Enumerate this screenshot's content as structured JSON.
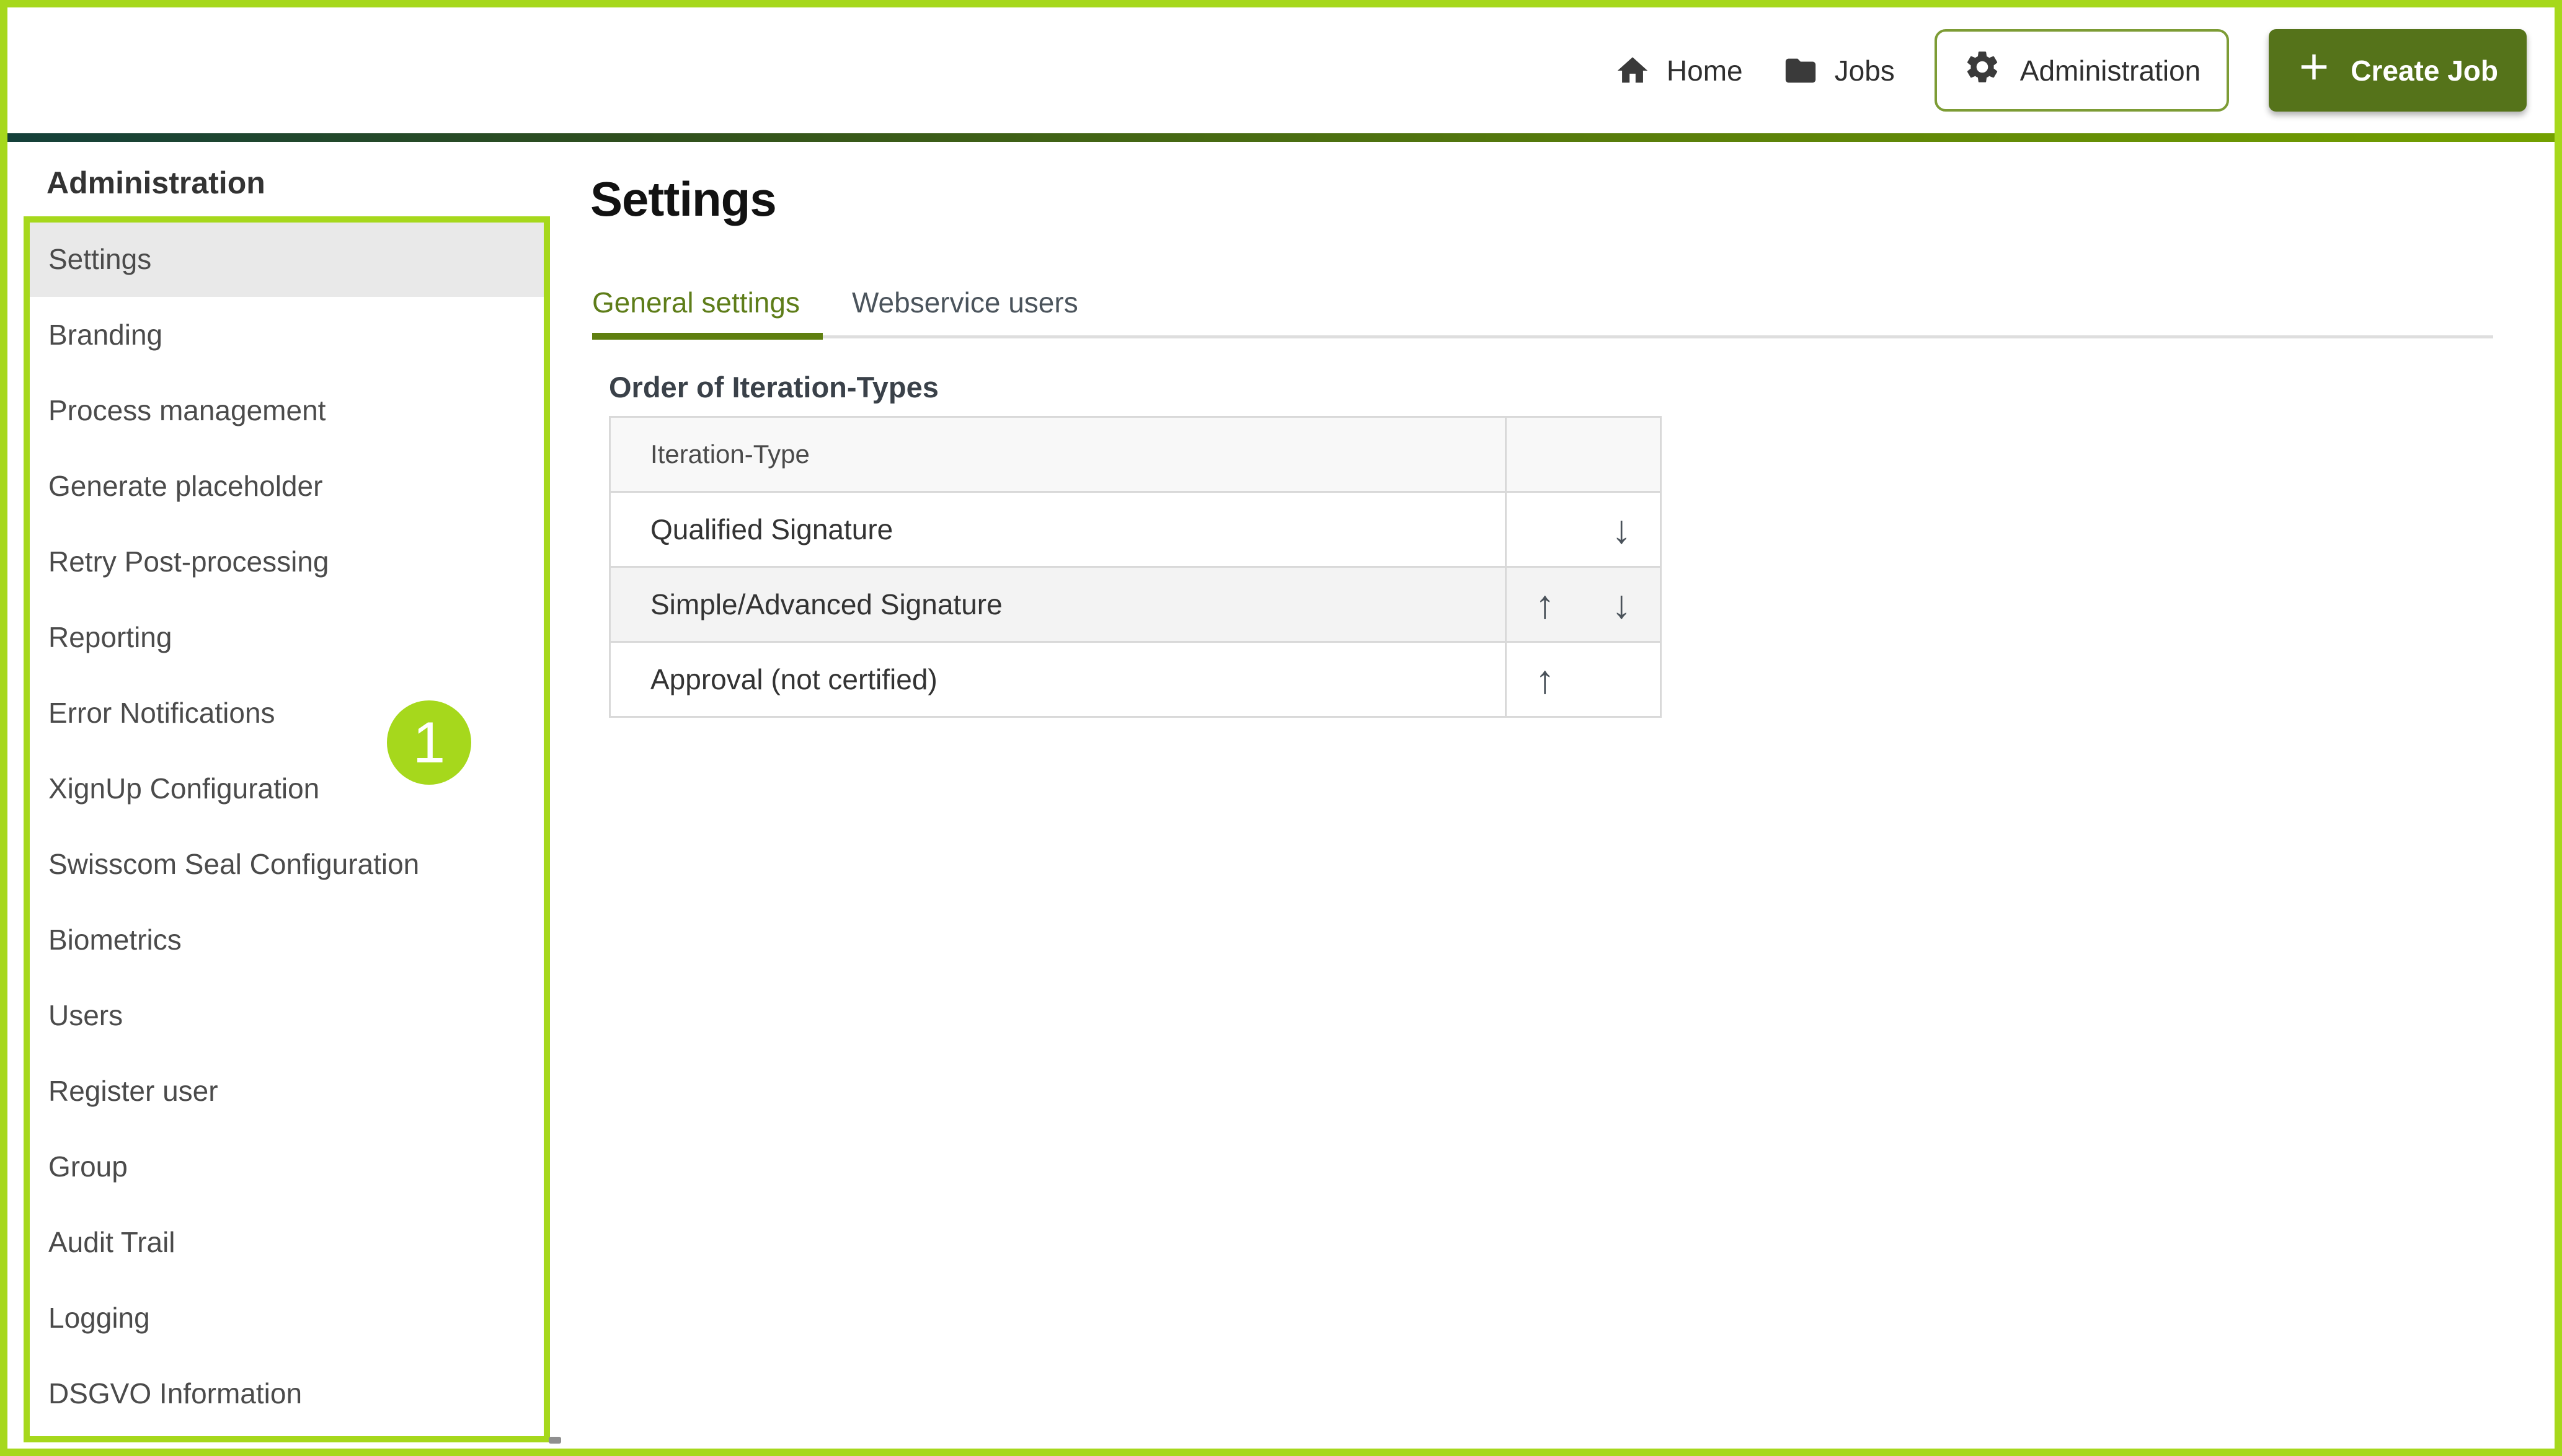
{
  "header": {
    "nav": [
      {
        "label": "Home",
        "icon": "home-icon"
      },
      {
        "label": "Jobs",
        "icon": "folder-icon"
      },
      {
        "label": "Administration",
        "icon": "gear-icon",
        "active": true
      }
    ],
    "create_job": {
      "label": "Create Job",
      "icon": "plus-icon"
    }
  },
  "sidebar": {
    "heading": "Administration",
    "selected_item": "Settings",
    "items": [
      "Settings",
      "Branding",
      "Process management",
      "Generate placeholder",
      "Retry Post-processing",
      "Reporting",
      "Error Notifications",
      "XignUp Configuration",
      "Swisscom Seal Configuration",
      "Biometrics",
      "Users",
      "Register user",
      "Group",
      "Audit Trail",
      "Logging",
      "DSGVO Information"
    ]
  },
  "main": {
    "title": "Settings",
    "tabs": [
      {
        "label": "General settings",
        "active": true
      },
      {
        "label": "Webservice users",
        "active": false
      }
    ],
    "section_heading": "Order of Iteration-Types",
    "table": {
      "column_header": "Iteration-Type",
      "rows": [
        {
          "label": "Qualified Signature",
          "move_up": false,
          "move_down": true,
          "highlighted": false
        },
        {
          "label": "Simple/Advanced Signature",
          "move_up": true,
          "move_down": true,
          "highlighted": true
        },
        {
          "label": "Approval (not certified)",
          "move_up": true,
          "move_down": false,
          "highlighted": false
        }
      ]
    },
    "icons": {
      "up_arrow": "↑",
      "down_arrow": "↓"
    }
  },
  "annotations": {
    "step_badge": "1"
  },
  "colors": {
    "annotation_lime": "#a6d81c",
    "button_olive": "#55731a",
    "pill_border": "#7d9c35",
    "active_tab": "#5e7d19",
    "tab_underline": "#5f7f10",
    "divider_gradient_start": "#14403a",
    "divider_gradient_end": "#73a000",
    "selected_item_bg": "#e9e9e9",
    "table_border": "#d9d9d9"
  }
}
